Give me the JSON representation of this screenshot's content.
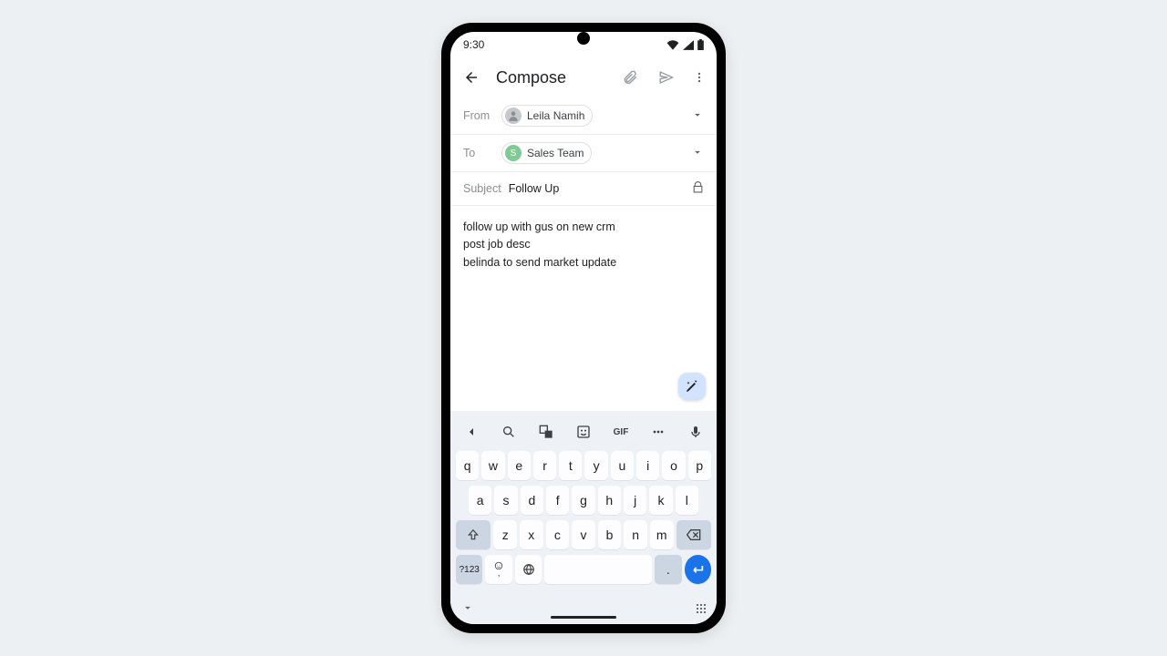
{
  "status": {
    "time": "9:30"
  },
  "appbar": {
    "title": "Compose"
  },
  "from": {
    "label": "From",
    "name": "Leila Namih"
  },
  "to": {
    "label": "To",
    "name": "Sales Team",
    "initial": "S"
  },
  "subject": {
    "label": "Subject",
    "text": "Follow Up"
  },
  "body": {
    "line1": "follow up with gus on new crm",
    "line2": "post job desc",
    "line3": "belinda to send market update"
  },
  "keyboard": {
    "gif": "GIF",
    "row1": [
      "q",
      "w",
      "e",
      "r",
      "t",
      "y",
      "u",
      "i",
      "o",
      "p"
    ],
    "row2": [
      "a",
      "s",
      "d",
      "f",
      "g",
      "h",
      "j",
      "k",
      "l"
    ],
    "row3": [
      "z",
      "x",
      "c",
      "v",
      "b",
      "n",
      "m"
    ],
    "symkey": "?123",
    "comma": ",",
    "period": "."
  }
}
